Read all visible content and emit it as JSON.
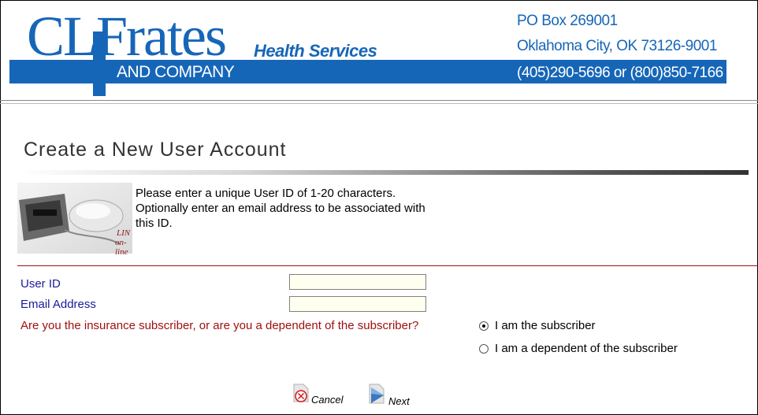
{
  "header": {
    "logo_main": "CLFrates",
    "logo_tagline": "Health Services",
    "logo_company": "AND COMPANY",
    "address_line1": "PO Box 269001",
    "address_line2": "Oklahoma City, OK 73126-9001",
    "phone": "(405)290-5696 or (800)850-7166",
    "brand_color": "#1666b8"
  },
  "page": {
    "title": "Create a New User Account"
  },
  "intro": {
    "text_line1": "Please enter a unique User ID of 1-20 characters.",
    "text_line2": "Optionally enter an email address to be associated with",
    "text_line3": "this ID.",
    "image_caption1": "LIN",
    "image_caption2": "on-line"
  },
  "form": {
    "user_id_label": "User ID",
    "user_id_value": "",
    "email_label": "Email Address",
    "email_value": "",
    "question": "Are you the insurance subscriber, or are you a dependent of the subscriber?",
    "option_subscriber": "I am the subscriber",
    "option_dependent": "I am a dependent of the subscriber",
    "selected_option": "I am the subscriber"
  },
  "buttons": {
    "cancel_label": "Cancel",
    "next_label": "Next"
  }
}
